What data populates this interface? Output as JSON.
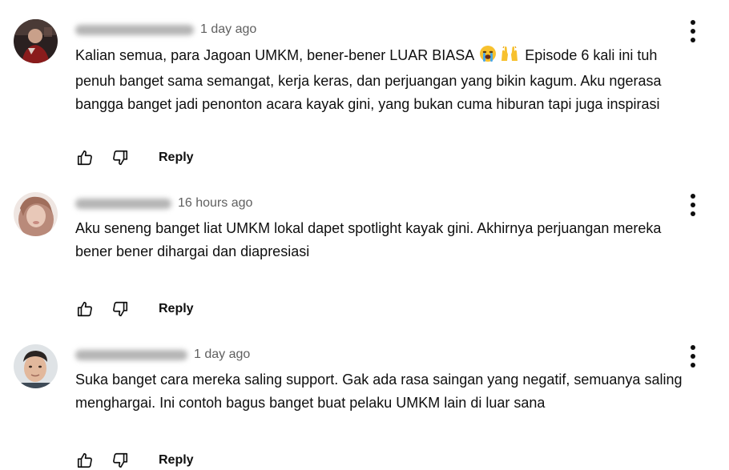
{
  "comments": [
    {
      "handle": "@Triyakusuma-x9t",
      "time": "1 day ago",
      "lines": [
        "Kalian semua, para Jagoan UMKM, bener-bener LUAR BIASA",
        "Episode 6 kali ini tuh",
        "penuh banget sama semangat, kerja keras, dan perjuangan yang bikin kagum. Aku ngerasa",
        "bangga banget jadi penonton acara kayak gini, yang bukan cuma hiburan tapi juga inspirasi"
      ],
      "emojis": [
        "loudly-crying-face",
        "raising-hands"
      ],
      "reply_label": "Reply"
    },
    {
      "handle": "@faridaarimay",
      "time": "16 hours ago",
      "lines": [
        "Aku seneng banget liat UMKM lokal dapet spotlight kayak gini. Akhirnya perjuangan mereka",
        "bener bener dihargai dan diapresiasi"
      ],
      "reply_label": "Reply"
    },
    {
      "handle": "@keminadiagustia",
      "time": "1 day ago",
      "lines": [
        "Suka banget cara mereka saling support. Gak ada rasa saingan yang negatif, semuanya saling",
        "menghargai. Ini contoh bagus banget buat pelaku UMKM lain di luar sana"
      ],
      "reply_label": "Reply"
    }
  ],
  "icons": {
    "like": "thumb-up-icon",
    "dislike": "thumb-down-icon",
    "menu": "more-vert-icon"
  },
  "colors": {
    "text": "#0f0f0f",
    "secondary": "#606060",
    "background": "#ffffff"
  }
}
